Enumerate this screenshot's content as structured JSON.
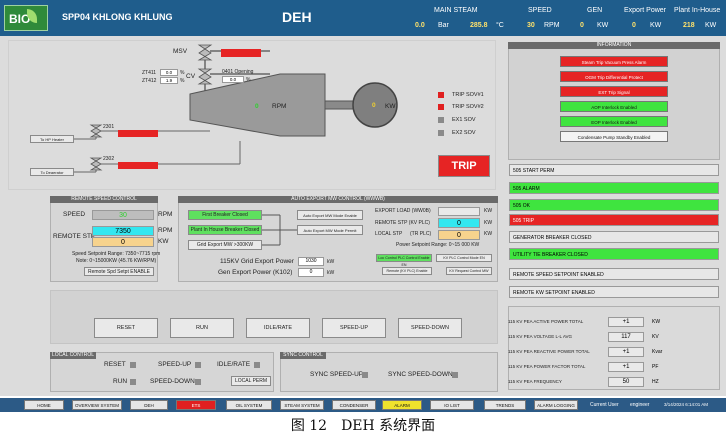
{
  "header": {
    "plant_title": "SPP04 KHLONG KHLUNG",
    "screen_title": "DEH",
    "logo_text": "BIO",
    "main_steam_label": "MAIN STEAM",
    "pressure_value": "0.0",
    "pressure_unit": "Bar",
    "temp_value": "285.8",
    "temp_unit": "°C",
    "speed_label": "SPEED",
    "speed_value": "30",
    "speed_unit": "RPM",
    "gen_label": "GEN",
    "gen_value": "0",
    "gen_unit": "KW",
    "export_label": "Export Power",
    "export_value": "0",
    "export_unit": "KW",
    "inhouse_label": "Plant In-House",
    "inhouse_value": "218",
    "inhouse_unit": "KW"
  },
  "diagram": {
    "msv_label": "MSV",
    "cv_label": "CV",
    "zt1": "ZT411",
    "zt1_val": "0.0",
    "zt2": "ZT412",
    "zt2_val": "1.9",
    "pct": "%",
    "open_label": "0401 Opening",
    "open_val": "0.0",
    "rpm_val": "0",
    "rpm_unit": "RPM",
    "kw_val": "0",
    "kw_unit": "KW",
    "valve1_id": "2301",
    "valve2_id": "2302",
    "to_hp_heater": "To HP Heater",
    "to_deaerator": "To Deaerator",
    "trip_sov1": "TRIP SOV#1",
    "trip_sov2": "TRIP SOV#2",
    "ex1_sov": "EX1 SOV",
    "ex2_sov": "EX2 SOV",
    "trip": "TRIP"
  },
  "remote_speed": {
    "title": "REMOTE SPEED CONTROL",
    "speed_label": "SPEED",
    "speed_val": "30",
    "rpm": "RPM",
    "remote_stp_label": "REMOTE STP",
    "stp_rpm_val": "7350",
    "stp_kw_val": "0",
    "kw": "KW",
    "range1": "Speed Setpoint Range: 7350~7715 rpm",
    "range2": "Note: 0~15000KW (45.76 KW/RPM)",
    "enable_btn": "Remote Spd Setpt ENABLE"
  },
  "auto_export": {
    "title": "AUTO EXPORT MW CONTROL (WWWB)",
    "first_breaker": "First Breaker Closed",
    "plant_inhouse": "Plant In House Breaker Closed",
    "grid_export": "Grid Export MW >300KW",
    "mode_enable": "Auto Export MW Mode Enable",
    "mode_permit": "Auto Export MW Mode Permit",
    "grid_export_power_label": "115KV Grid Export Power",
    "grid_export_power_val": "1030",
    "gen_export_label": "Gen Export Power (K102)",
    "gen_export_val": "0",
    "kw": "kW",
    "export_load": "EXPORT LOAD (WW0B)",
    "remote_stp_kv": "REMOTE STP (KV PLC)",
    "local_stp": "LOCAL STP",
    "tr_plc": "(TR PLC)",
    "val_0": "0",
    "power_range": "Power Setpoint Range: 0~15 000 KW",
    "loc_control_btn": "Loc Control PLC Control Enable EN",
    "kv_plc_btn": "KV PLC Control Mode EN",
    "remote_kv_btn": "Remote (KV PLC) Enable",
    "kv_request_btn": "KV Request Control MW"
  },
  "info": {
    "title": "INFORMATION",
    "items": [
      {
        "label": "Steam Trip Vacuum Press Alarm",
        "color": "r"
      },
      {
        "label": "OGM Trip Differential Protect",
        "color": "r"
      },
      {
        "label": "EXT Trip Signal",
        "color": "r"
      },
      {
        "label": "AOP Interlock Enabled",
        "color": "g"
      },
      {
        "label": "EOP Interlock Enabled",
        "color": "g"
      },
      {
        "label": "Condensate Pump Standby Enabled",
        "color": "w"
      }
    ],
    "status": [
      {
        "label": "505 START PERM",
        "color": "w"
      },
      {
        "label": "505 ALARM",
        "color": "g"
      },
      {
        "label": "505 OK",
        "color": "g"
      },
      {
        "label": "505 TRIP",
        "color": "r"
      },
      {
        "label": "GENERATOR BREAKER CLOSED",
        "color": "w"
      },
      {
        "label": "UTILITY TIE BREAKER CLOSED",
        "color": "g"
      },
      {
        "label": "REMOTE SPEED SETPOINT ENABLED",
        "color": "w"
      },
      {
        "label": "REMOTE KW SETPOINT ENABLED",
        "color": "w"
      }
    ],
    "measures": [
      {
        "label": "115 KV PEA ACTIVE POWER TOTAL",
        "val": "+1",
        "unit": "KW"
      },
      {
        "label": "115 KV PEA VOLTAGE L-L AVG",
        "val": "117",
        "unit": "KV"
      },
      {
        "label": "115 KV PEA REACTIVE POWER TOTAL",
        "val": "+1",
        "unit": "Kvar"
      },
      {
        "label": "115 KV PEA POWER FACTOR TOTAL",
        "val": "+1",
        "unit": "PF"
      },
      {
        "label": "115 KV PEA FREQUENCY",
        "val": "50",
        "unit": "HZ"
      }
    ]
  },
  "buttons": {
    "reset": "RESET",
    "run": "RUN",
    "idle_rate": "IDLE/RATE",
    "speed_up": "SPEED-UP",
    "speed_down": "SPEED-DOWN"
  },
  "local_control": {
    "title": "LOCAL CONTROL",
    "reset": "RESET",
    "speed_up": "SPEED-UP",
    "idle_rate": "IDLE/RATE",
    "run": "RUN",
    "speed_down": "SPEED-DOWN",
    "local_perm": "LOCAL PERM"
  },
  "sync_control": {
    "title": "SYNC CONTROL",
    "sync_up": "SYNC SPEED-UP",
    "sync_down": "SYNC SPEED-DOWN"
  },
  "nav": {
    "items": [
      {
        "label": "HOME",
        "color": ""
      },
      {
        "label": "OVERVIEW SYSTEM",
        "color": ""
      },
      {
        "label": "DEH",
        "color": ""
      },
      {
        "label": "ETS",
        "color": "r"
      },
      {
        "label": "OIL SYSTEM",
        "color": ""
      },
      {
        "label": "STEAM SYSTEM",
        "color": ""
      },
      {
        "label": "CONDENSER",
        "color": ""
      },
      {
        "label": "ALARM",
        "color": "y"
      },
      {
        "label": "IO LIST",
        "color": ""
      },
      {
        "label": "TRENDS",
        "color": ""
      },
      {
        "label": "ALARM LOGGING",
        "color": ""
      }
    ],
    "current_user_label": "Current User",
    "current_user": "engineer",
    "datetime": "3/14/2024 6:14:01 AM"
  },
  "caption": "图 12　DEH 系统界面"
}
